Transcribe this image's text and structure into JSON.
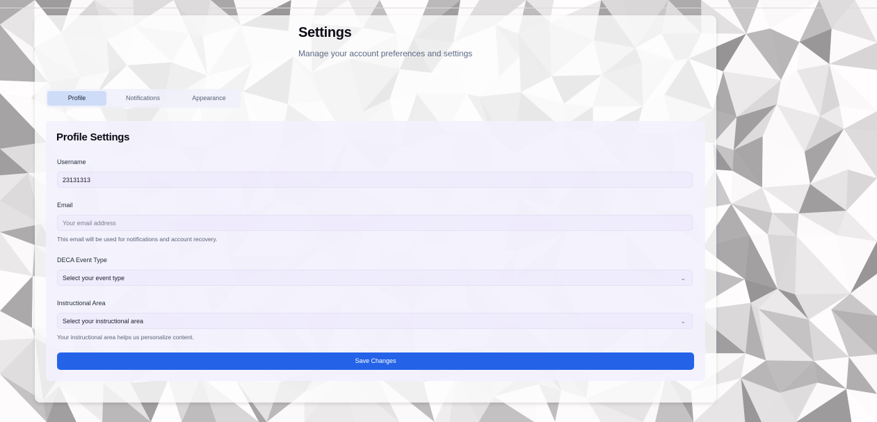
{
  "header": {
    "title": "Settings",
    "subtitle": "Manage your account preferences and settings"
  },
  "tabs": [
    {
      "label": "Profile",
      "active": true
    },
    {
      "label": "Notifications",
      "active": false
    },
    {
      "label": "Appearance",
      "active": false
    }
  ],
  "profile": {
    "title": "Profile Settings",
    "username": {
      "label": "Username",
      "value": "23131313"
    },
    "email": {
      "label": "Email",
      "placeholder": "Your email address",
      "help": "This email will be used for notifications and account recovery."
    },
    "event_type": {
      "label": "DECA Event Type",
      "selected": "Select your event type"
    },
    "instructional_area": {
      "label": "Instructional Area",
      "selected": "Select your instructional area",
      "help": "Your instructional area helps us personalize content."
    },
    "save_label": "Save Changes"
  },
  "colors": {
    "accent": "#2463e8",
    "active_tab": "#cfdcf7"
  },
  "icons": {
    "select_chevron": "chevron-down-icon"
  }
}
